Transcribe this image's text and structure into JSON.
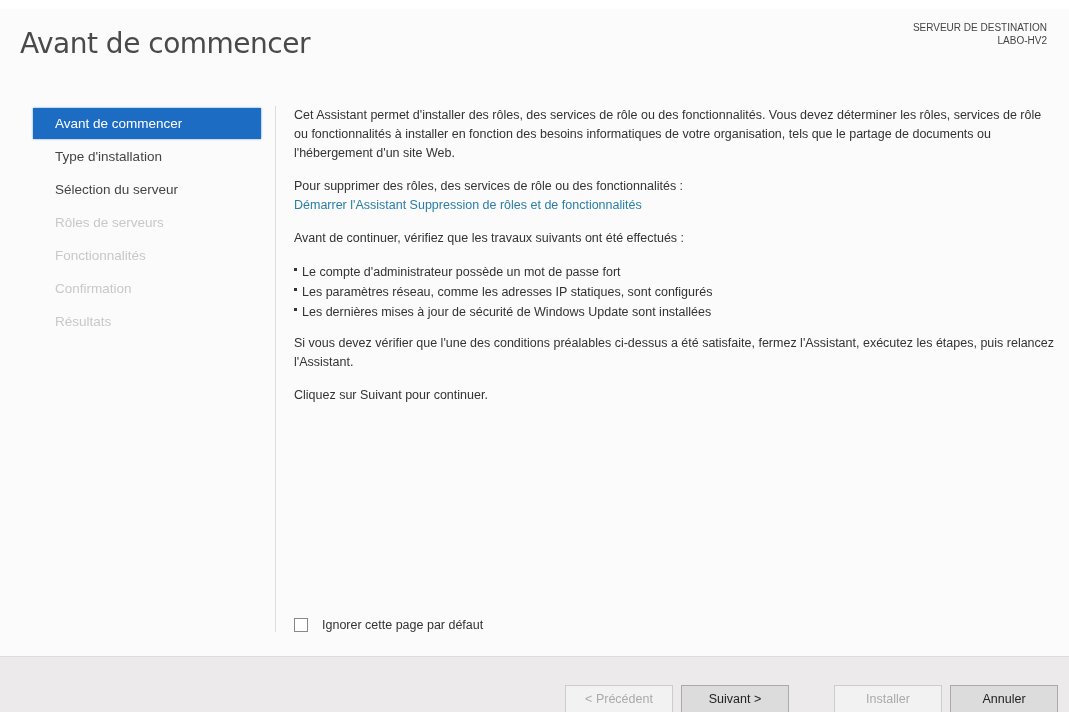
{
  "title": "Avant de commencer",
  "destination": {
    "label": "SERVEUR DE DESTINATION",
    "server": "LABO-HV2"
  },
  "steps": [
    {
      "label": "Avant de commencer",
      "selected": true,
      "disabled": false
    },
    {
      "label": "Type d'installation",
      "selected": false,
      "disabled": false
    },
    {
      "label": "Sélection du serveur",
      "selected": false,
      "disabled": false
    },
    {
      "label": "Rôles de serveurs",
      "selected": false,
      "disabled": true
    },
    {
      "label": "Fonctionnalités",
      "selected": false,
      "disabled": true
    },
    {
      "label": "Confirmation",
      "selected": false,
      "disabled": true
    },
    {
      "label": "Résultats",
      "selected": false,
      "disabled": true
    }
  ],
  "content": {
    "intro": "Cet Assistant permet d'installer des rôles, des services de rôle ou des fonctionnalités. Vous devez déterminer les rôles, services de rôle ou fonctionnalités à installer en fonction des besoins informatiques de votre organisation, tels que le partage de documents ou l'hébergement d'un site Web.",
    "remove_prompt": "Pour supprimer des rôles, des services de rôle ou des fonctionnalités :",
    "remove_link": "Démarrer l'Assistant Suppression de rôles et de fonctionnalités",
    "check_prompt": "Avant de continuer, vérifiez que les travaux suivants ont été effectués :",
    "checklist": [
      "Le compte d'administrateur possède un mot de passe fort",
      "Les paramètres réseau, comme les adresses IP statiques, sont configurés",
      "Les dernières mises à jour de sécurité de Windows Update sont installées"
    ],
    "note": "Si vous devez vérifier que l'une des conditions préalables ci-dessus a été satisfaite, fermez l'Assistant, exécutez les étapes, puis relancez l'Assistant.",
    "continue_text": "Cliquez sur Suivant pour continuer."
  },
  "skip_checkbox": {
    "label": "Ignorer cette page par défaut",
    "checked": false
  },
  "buttons": [
    {
      "label": "< Précédent",
      "disabled": true
    },
    {
      "label": "Suivant >",
      "disabled": false
    },
    {
      "label": "Installer",
      "disabled": true
    },
    {
      "label": "Annuler",
      "disabled": false
    }
  ]
}
